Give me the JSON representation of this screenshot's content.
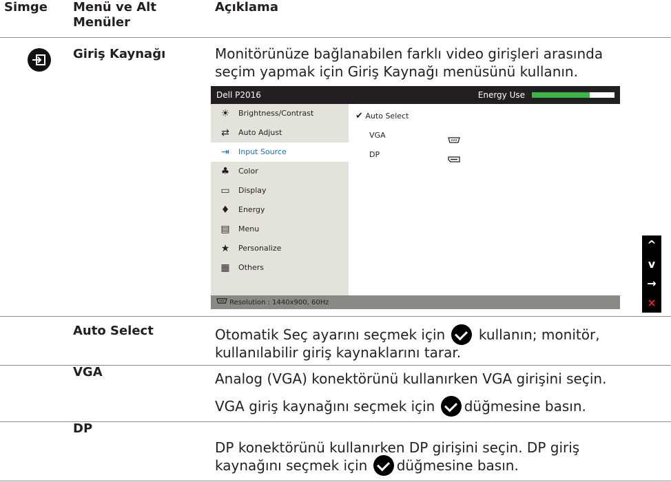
{
  "headers": {
    "icon": "Simge",
    "menu_line1": "Menü ve Alt",
    "menu_line2": "Menüler",
    "description": "Açıklama"
  },
  "section": {
    "title": "Giriş Kaynağı",
    "icon": "input-source-icon",
    "desc_line1": "Monitörünüze bağlanabilen farklı video girişleri arasında",
    "desc_line2": "seçim yapmak için Giriş Kaynağı menüsünü kullanın."
  },
  "osd": {
    "model": "Dell P2016",
    "energy_label": "Energy Use",
    "energy_level": 0.7,
    "menu_items": [
      {
        "label": "Brightness/Contrast",
        "icon": "sun-icon"
      },
      {
        "label": "Auto Adjust",
        "icon": "arrows-icon"
      },
      {
        "label": "Input Source",
        "icon": "input-icon"
      },
      {
        "label": "Color",
        "icon": "color-icon"
      },
      {
        "label": "Display",
        "icon": "monitor-icon"
      },
      {
        "label": "Energy",
        "icon": "drop-icon"
      },
      {
        "label": "Menu",
        "icon": "menu-icon"
      },
      {
        "label": "Personalize",
        "icon": "star-icon"
      },
      {
        "label": "Others",
        "icon": "grid-icon"
      }
    ],
    "selected_item": "Input Source",
    "options": [
      {
        "label": "Auto Select",
        "checked": true
      },
      {
        "label": "VGA",
        "icon": "vga-port-icon"
      },
      {
        "label": "DP",
        "icon": "dp-port-icon"
      }
    ],
    "resolution": "Resolution : 1440x900, 60Hz"
  },
  "nav_buttons": [
    "up-icon",
    "down-icon",
    "enter-icon",
    "close-icon"
  ],
  "rows": [
    {
      "title": "Auto Select",
      "desc_a": "Otomatik Seç ayarını seçmek için",
      "desc_b": " kullanın; monitör,",
      "desc_line2": "kullanılabilir giriş kaynaklarını tarar."
    },
    {
      "title": "VGA",
      "desc_line1": "Analog (VGA) konektörünü kullanırken VGA girişini seçin.",
      "desc_a": "VGA giriş kaynağını seçmek için",
      "desc_b": "düğmesine basın."
    },
    {
      "title": "DP",
      "desc_line1": "DP konektörünü kullanırken DP girişini seçin. DP giriş",
      "desc_a": "kaynağını seçmek için",
      "desc_b": "düğmesine basın."
    }
  ]
}
